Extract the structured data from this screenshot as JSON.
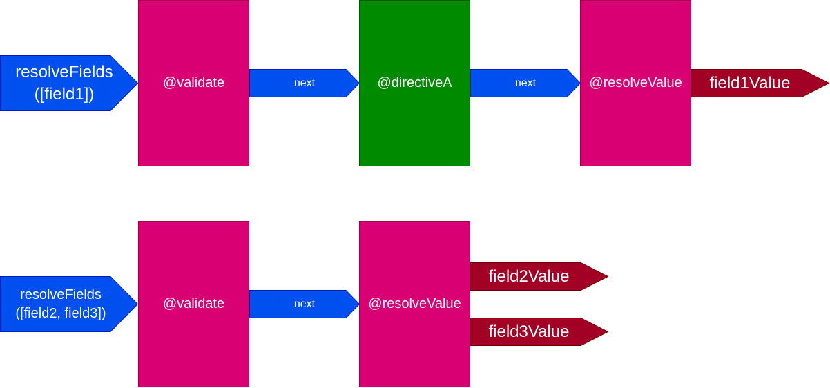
{
  "colors": {
    "input_arrow_fill": "#0050ef",
    "input_arrow_stroke": "#001dbc",
    "directive_fill": "#d80073",
    "directive_stroke": "#a50040",
    "custom_directive_fill": "#008a00",
    "custom_directive_stroke": "#005700",
    "output_fill": "#a20025",
    "output_stroke": "#6f0000",
    "text": "#ffffff"
  },
  "row1": {
    "input": "resolveFields\n([field1])",
    "validate": "@validate",
    "next1": "next",
    "directive_a": "@directiveA",
    "next2": "next",
    "resolve_value": "@resolveValue",
    "output": "field1Value"
  },
  "row2": {
    "input": "resolveFields\n([field2, field3])",
    "validate": "@validate",
    "next1": "next",
    "resolve_value": "@resolveValue",
    "output1": "field2Value",
    "output2": "field3Value"
  }
}
